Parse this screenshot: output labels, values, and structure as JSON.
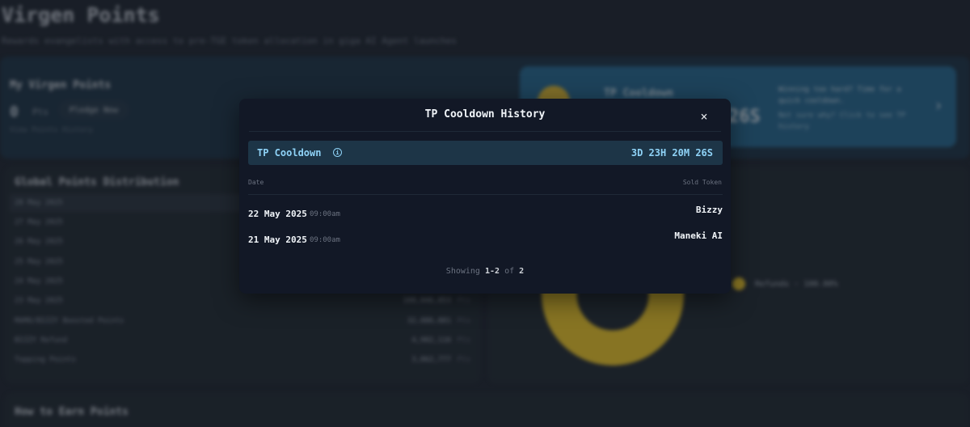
{
  "page": {
    "title": "Virgen Points",
    "subtitle": "Rewards evangelists with access to pre-TGE token allocation in giga AI Agent launches"
  },
  "my_points": {
    "title": "My Virgen Points",
    "value": "0",
    "unit": "Pts",
    "pledge_button": "Pledge Now",
    "link_text": "View Points History"
  },
  "tp_card": {
    "label": "TP Cooldown",
    "time": "26S",
    "message_1": "Winning too hard? Time for a quick cooldown.",
    "message_2": "Not sure why? Click to see TP history"
  },
  "distribution": {
    "title": "Global Points Distribution",
    "rows": [
      {
        "label": "28 May 2025",
        "value": "",
        "unit": ""
      },
      {
        "label": "27 May 2025",
        "value": "",
        "unit": ""
      },
      {
        "label": "26 May 2025",
        "value": "",
        "unit": ""
      },
      {
        "label": "25 May 2025",
        "value": "",
        "unit": ""
      },
      {
        "label": "24 May 2025",
        "value": "",
        "unit": ""
      },
      {
        "label": "23 May 2025",
        "value": "108,046,853",
        "unit": "Pts"
      },
      {
        "label": "MAMO/BIZZY Boosted Points",
        "value": "32,886,881",
        "unit": "Pts"
      },
      {
        "label": "BIZZY Refund",
        "value": "4,902,116",
        "unit": "Pts"
      },
      {
        "label": "Topping Points",
        "value": "3,862,777",
        "unit": "Pts"
      }
    ]
  },
  "chart": {
    "legend": "Refunds - 100.00%"
  },
  "earn": {
    "title": "How to Earn Points"
  },
  "modal": {
    "title": "TP Cooldown History",
    "close_label": "×",
    "cooldown_label": "TP Cooldown",
    "info_glyph": "i",
    "cooldown_time": "3D 23H 20M 26S",
    "columns": {
      "date": "Date",
      "token": "Sold Token"
    },
    "rows": [
      {
        "date": "22 May 2025",
        "time": "09:00am",
        "token": "Bizzy"
      },
      {
        "date": "21 May 2025",
        "time": "09:00am",
        "token": "Maneki AI"
      }
    ],
    "pager": {
      "prefix": "Showing",
      "range": "1-2",
      "of": "of",
      "total": "2"
    }
  },
  "colors": {
    "accent": "#8fd3f7",
    "donut": "#f7cf2f",
    "modal_bg": "#121826",
    "banner_bg": "#1d3547"
  }
}
